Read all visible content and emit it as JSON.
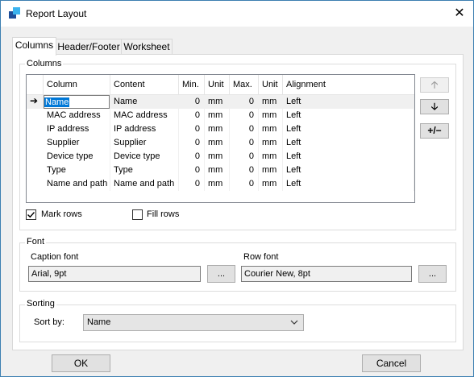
{
  "window": {
    "title": "Report Layout",
    "close_glyph": "✕"
  },
  "tabs": [
    {
      "label": "Columns",
      "active": true
    },
    {
      "label": "Header/Footer",
      "active": false
    },
    {
      "label": "Worksheet",
      "active": false
    }
  ],
  "columns_group": {
    "label": "Columns",
    "headers": [
      "Column",
      "Content",
      "Min.",
      "Unit",
      "Max.",
      "Unit",
      "Alignment"
    ],
    "rows": [
      {
        "column": "Name",
        "content": "Name",
        "min": "0",
        "unit1": "mm",
        "max": "0",
        "unit2": "mm",
        "align": "Left"
      },
      {
        "column": "MAC address",
        "content": "MAC address",
        "min": "0",
        "unit1": "mm",
        "max": "0",
        "unit2": "mm",
        "align": "Left"
      },
      {
        "column": "IP address",
        "content": "IP address",
        "min": "0",
        "unit1": "mm",
        "max": "0",
        "unit2": "mm",
        "align": "Left"
      },
      {
        "column": "Supplier",
        "content": "Supplier",
        "min": "0",
        "unit1": "mm",
        "max": "0",
        "unit2": "mm",
        "align": "Left"
      },
      {
        "column": "Device type",
        "content": "Device type",
        "min": "0",
        "unit1": "mm",
        "max": "0",
        "unit2": "mm",
        "align": "Left"
      },
      {
        "column": "Type",
        "content": "Type",
        "min": "0",
        "unit1": "mm",
        "max": "0",
        "unit2": "mm",
        "align": "Left"
      },
      {
        "column": "Name and path",
        "content": "Name and path",
        "min": "0",
        "unit1": "mm",
        "max": "0",
        "unit2": "mm",
        "align": "Left"
      }
    ],
    "move_up_glyph": "🡡",
    "move_down_glyph": "🡣",
    "add_remove_label": "+/−",
    "mark_rows": {
      "label": "Mark rows",
      "checked": true
    },
    "fill_rows": {
      "label": "Fill rows",
      "checked": false
    }
  },
  "font_group": {
    "label": "Font",
    "caption_label": "Caption font",
    "caption_value": "Arial, 9pt",
    "row_label": "Row font",
    "row_value": "Courier New, 8pt",
    "browse_label": "..."
  },
  "sorting_group": {
    "label": "Sorting",
    "sort_by_label": "Sort by:",
    "sort_by_value": "Name"
  },
  "buttons": {
    "ok": "OK",
    "cancel": "Cancel"
  }
}
